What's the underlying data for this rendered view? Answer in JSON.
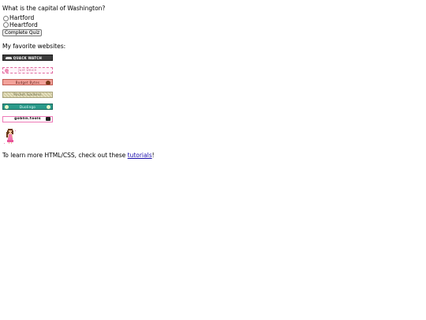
{
  "quiz": {
    "question": "What is the capital of Washington?",
    "options": [
      "Hartford",
      "Heartford"
    ],
    "submit_label": "Complete Quiz"
  },
  "favorites": {
    "heading": "My favorite websites:",
    "badges": [
      {
        "label": "QUACK WATCH",
        "style": "dark",
        "bg": "#3c3c3c"
      },
      {
        "label": "Just Devin",
        "style": "dashed-pink",
        "bg": "#fff5fa"
      },
      {
        "label": "Budget Bytes",
        "style": "salmon",
        "bg": "#f2a29a"
      },
      {
        "label": "Pocket Gardens",
        "style": "pattern",
        "bg": "#e7e2c3"
      },
      {
        "label": "Duolingo",
        "style": "teal",
        "bg": "#2a9a8a"
      },
      {
        "label": "goblin.tools",
        "style": "white-pink",
        "bg": "#ffffff"
      }
    ]
  },
  "footer": {
    "text": "To learn more HTML/CSS, check out these ",
    "link_text": "tutorials",
    "suffix": "!",
    "link_color": "#1a0dab"
  }
}
